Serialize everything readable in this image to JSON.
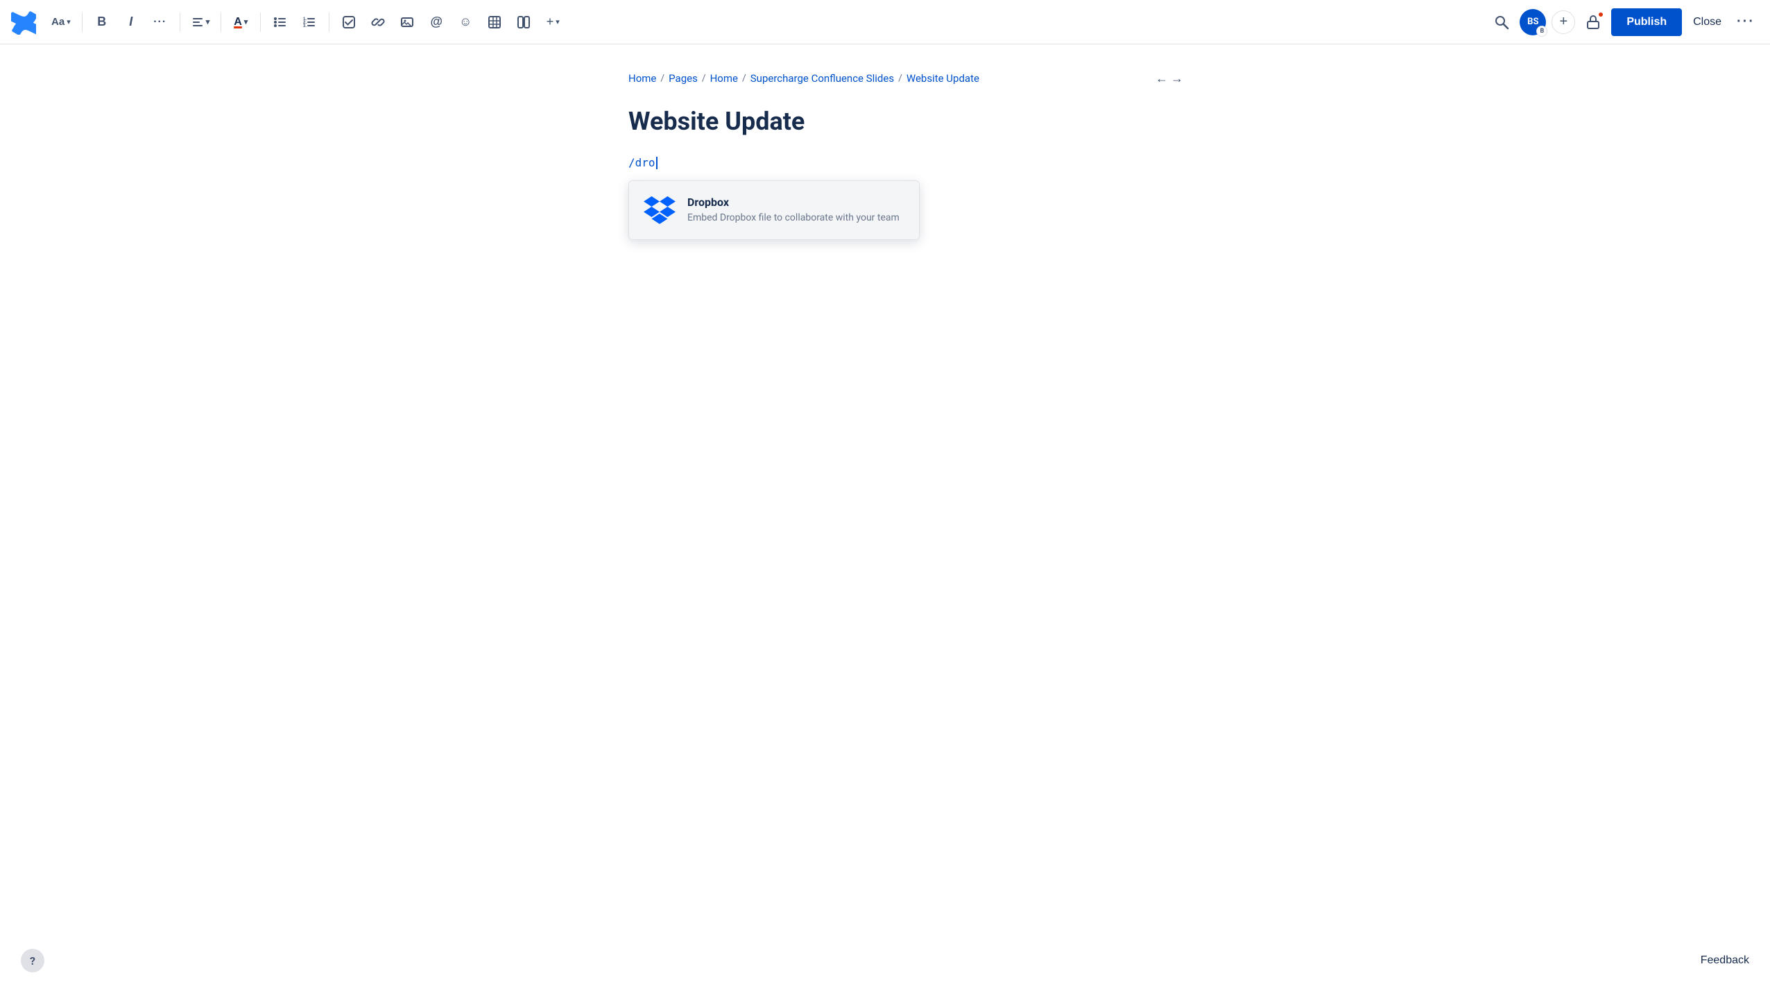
{
  "toolbar": {
    "logo_label": "Confluence",
    "font_label": "Aa",
    "font_dropdown": "▾",
    "bold_label": "B",
    "italic_label": "I",
    "more_format_label": "···",
    "align_label": "≡",
    "align_dropdown": "▾",
    "text_color_label": "A",
    "text_color_dropdown": "▾",
    "bullet_label": "•≡",
    "number_label": "1≡",
    "task_label": "✓",
    "link_label": "🔗",
    "image_label": "🖼",
    "at_label": "@",
    "emoji_label": "☺",
    "table_label": "⊞",
    "layout_label": "▥",
    "insert_label": "+",
    "insert_dropdown": "▾",
    "search_label": "🔍",
    "avatar_initials": "BS",
    "avatar_badge": "B",
    "add_btn": "+",
    "publish_label": "Publish",
    "close_label": "Close",
    "more_label": "···"
  },
  "breadcrumb": {
    "items": [
      {
        "label": "Home"
      },
      {
        "label": "Pages"
      },
      {
        "label": "Home"
      },
      {
        "label": "Supercharge Confluence Slides"
      },
      {
        "label": "Website Update"
      }
    ],
    "separator": "/"
  },
  "page": {
    "title": "Website Update",
    "editor_command": "/dro"
  },
  "dropdown": {
    "item": {
      "title": "Dropbox",
      "description": "Embed Dropbox file to collaborate with your team"
    }
  },
  "footer": {
    "help_label": "?",
    "feedback_label": "Feedback"
  },
  "colors": {
    "accent_blue": "#0052cc",
    "text_dark": "#172b4d",
    "text_muted": "#6b778c",
    "border": "#dfe1e6",
    "bg_hover": "#f4f5f7"
  }
}
